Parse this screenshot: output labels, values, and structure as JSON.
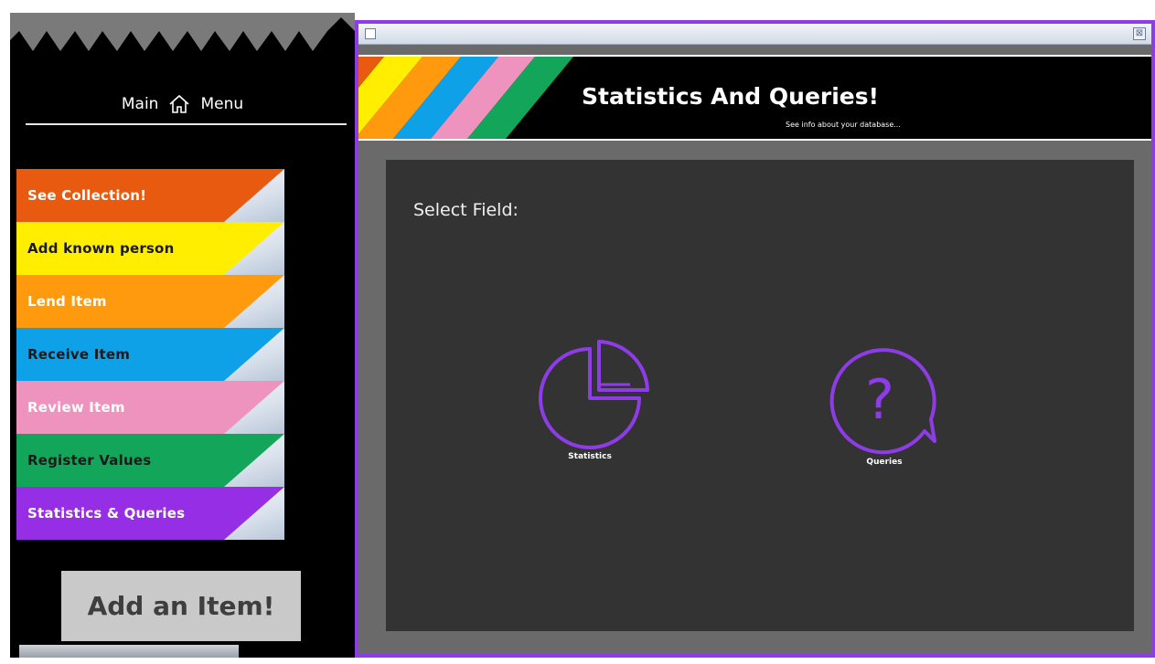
{
  "sidebar": {
    "title_left": "Main",
    "title_right": "Menu",
    "items": [
      {
        "label": "See Collection!",
        "bg": "#e85a10",
        "fg": "#ffffff"
      },
      {
        "label": "Add known person",
        "bg": "#ffee00",
        "fg": "#1a1a1a"
      },
      {
        "label": "Lend Item",
        "bg": "#ff9a0e",
        "fg": "#ffffff"
      },
      {
        "label": "Receive Item",
        "bg": "#0fa1e8",
        "fg": "#1a1a1a"
      },
      {
        "label": "Review Item",
        "bg": "#ee93bd",
        "fg": "#ffffff"
      },
      {
        "label": "Register Values",
        "bg": "#13a65a",
        "fg": "#1a1a1a"
      },
      {
        "label": "Statistics & Queries",
        "bg": "#962ee6",
        "fg": "#ffffff"
      }
    ],
    "add_button": "Add an Item!"
  },
  "frame": {
    "close_glyph": "⊠",
    "accent": "#8e3ce6"
  },
  "banner": {
    "title": "Statistics And Queries!",
    "subtitle": "See info about your database..."
  },
  "panel": {
    "heading": "Select Field:",
    "options": [
      {
        "label": "Statistics",
        "icon": "pie-chart-icon"
      },
      {
        "label": "Queries",
        "icon": "question-bubble-icon"
      }
    ]
  }
}
